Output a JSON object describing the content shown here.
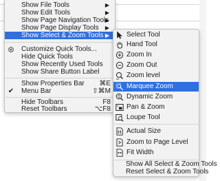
{
  "main_menu": {
    "items": [
      {
        "label": "Show File Tools",
        "submenu": true
      },
      {
        "label": "Show Edit Tools",
        "submenu": true
      },
      {
        "label": "Show Page Navigation Tools",
        "submenu": true
      },
      {
        "label": "Show Page Display Tools",
        "submenu": true
      },
      {
        "label": "Show Select & Zoom Tools",
        "submenu": true,
        "highlighted": true
      },
      {
        "label": "Customize Quick Tools..."
      },
      {
        "label": "Hide Quick Tools"
      },
      {
        "label": "Show Recently Used Tools"
      },
      {
        "label": "Show Share Button Label"
      },
      {
        "label": "Show Properties Bar",
        "shortcut": "⌘E"
      },
      {
        "label": "Menu Bar",
        "shortcut": "⇧⌘M",
        "checked": true,
        "check": "✔"
      },
      {
        "label": "Hide Toolbars",
        "shortcut": "F8"
      },
      {
        "label": "Reset Toolbars",
        "shortcut": "⌥F8"
      }
    ],
    "arrow": "▶"
  },
  "submenu": {
    "items": [
      {
        "label": "Select Tool",
        "icon": "arrow-cursor-icon"
      },
      {
        "label": "Hand Tool",
        "icon": "hand-icon"
      },
      {
        "label": "Zoom In",
        "icon": "zoom-in-icon"
      },
      {
        "label": "Zoom Out",
        "icon": "zoom-out-icon"
      },
      {
        "label": "Zoom level",
        "icon": "zoom-level-icon"
      },
      {
        "label": "Marquee Zoom",
        "icon": "marquee-zoom-icon",
        "highlighted": true
      },
      {
        "label": "Dynamic Zoom",
        "icon": "dynamic-zoom-icon"
      },
      {
        "label": "Pan & Zoom",
        "icon": "pan-zoom-icon"
      },
      {
        "label": "Loupe Tool",
        "icon": "loupe-icon"
      },
      {
        "label": "Actual Size",
        "icon": "actual-size-icon"
      },
      {
        "label": "Zoom to Page Level",
        "icon": "zoom-to-page-icon"
      },
      {
        "label": "Fit Width",
        "icon": "fit-width-icon"
      },
      {
        "label": "Show All Select & Zoom Tools"
      },
      {
        "label": "Reset Select & Zoom Tools"
      }
    ]
  },
  "colors": {
    "highlight": "#2f6fe0",
    "menu_bg": "#f2f2f2"
  }
}
